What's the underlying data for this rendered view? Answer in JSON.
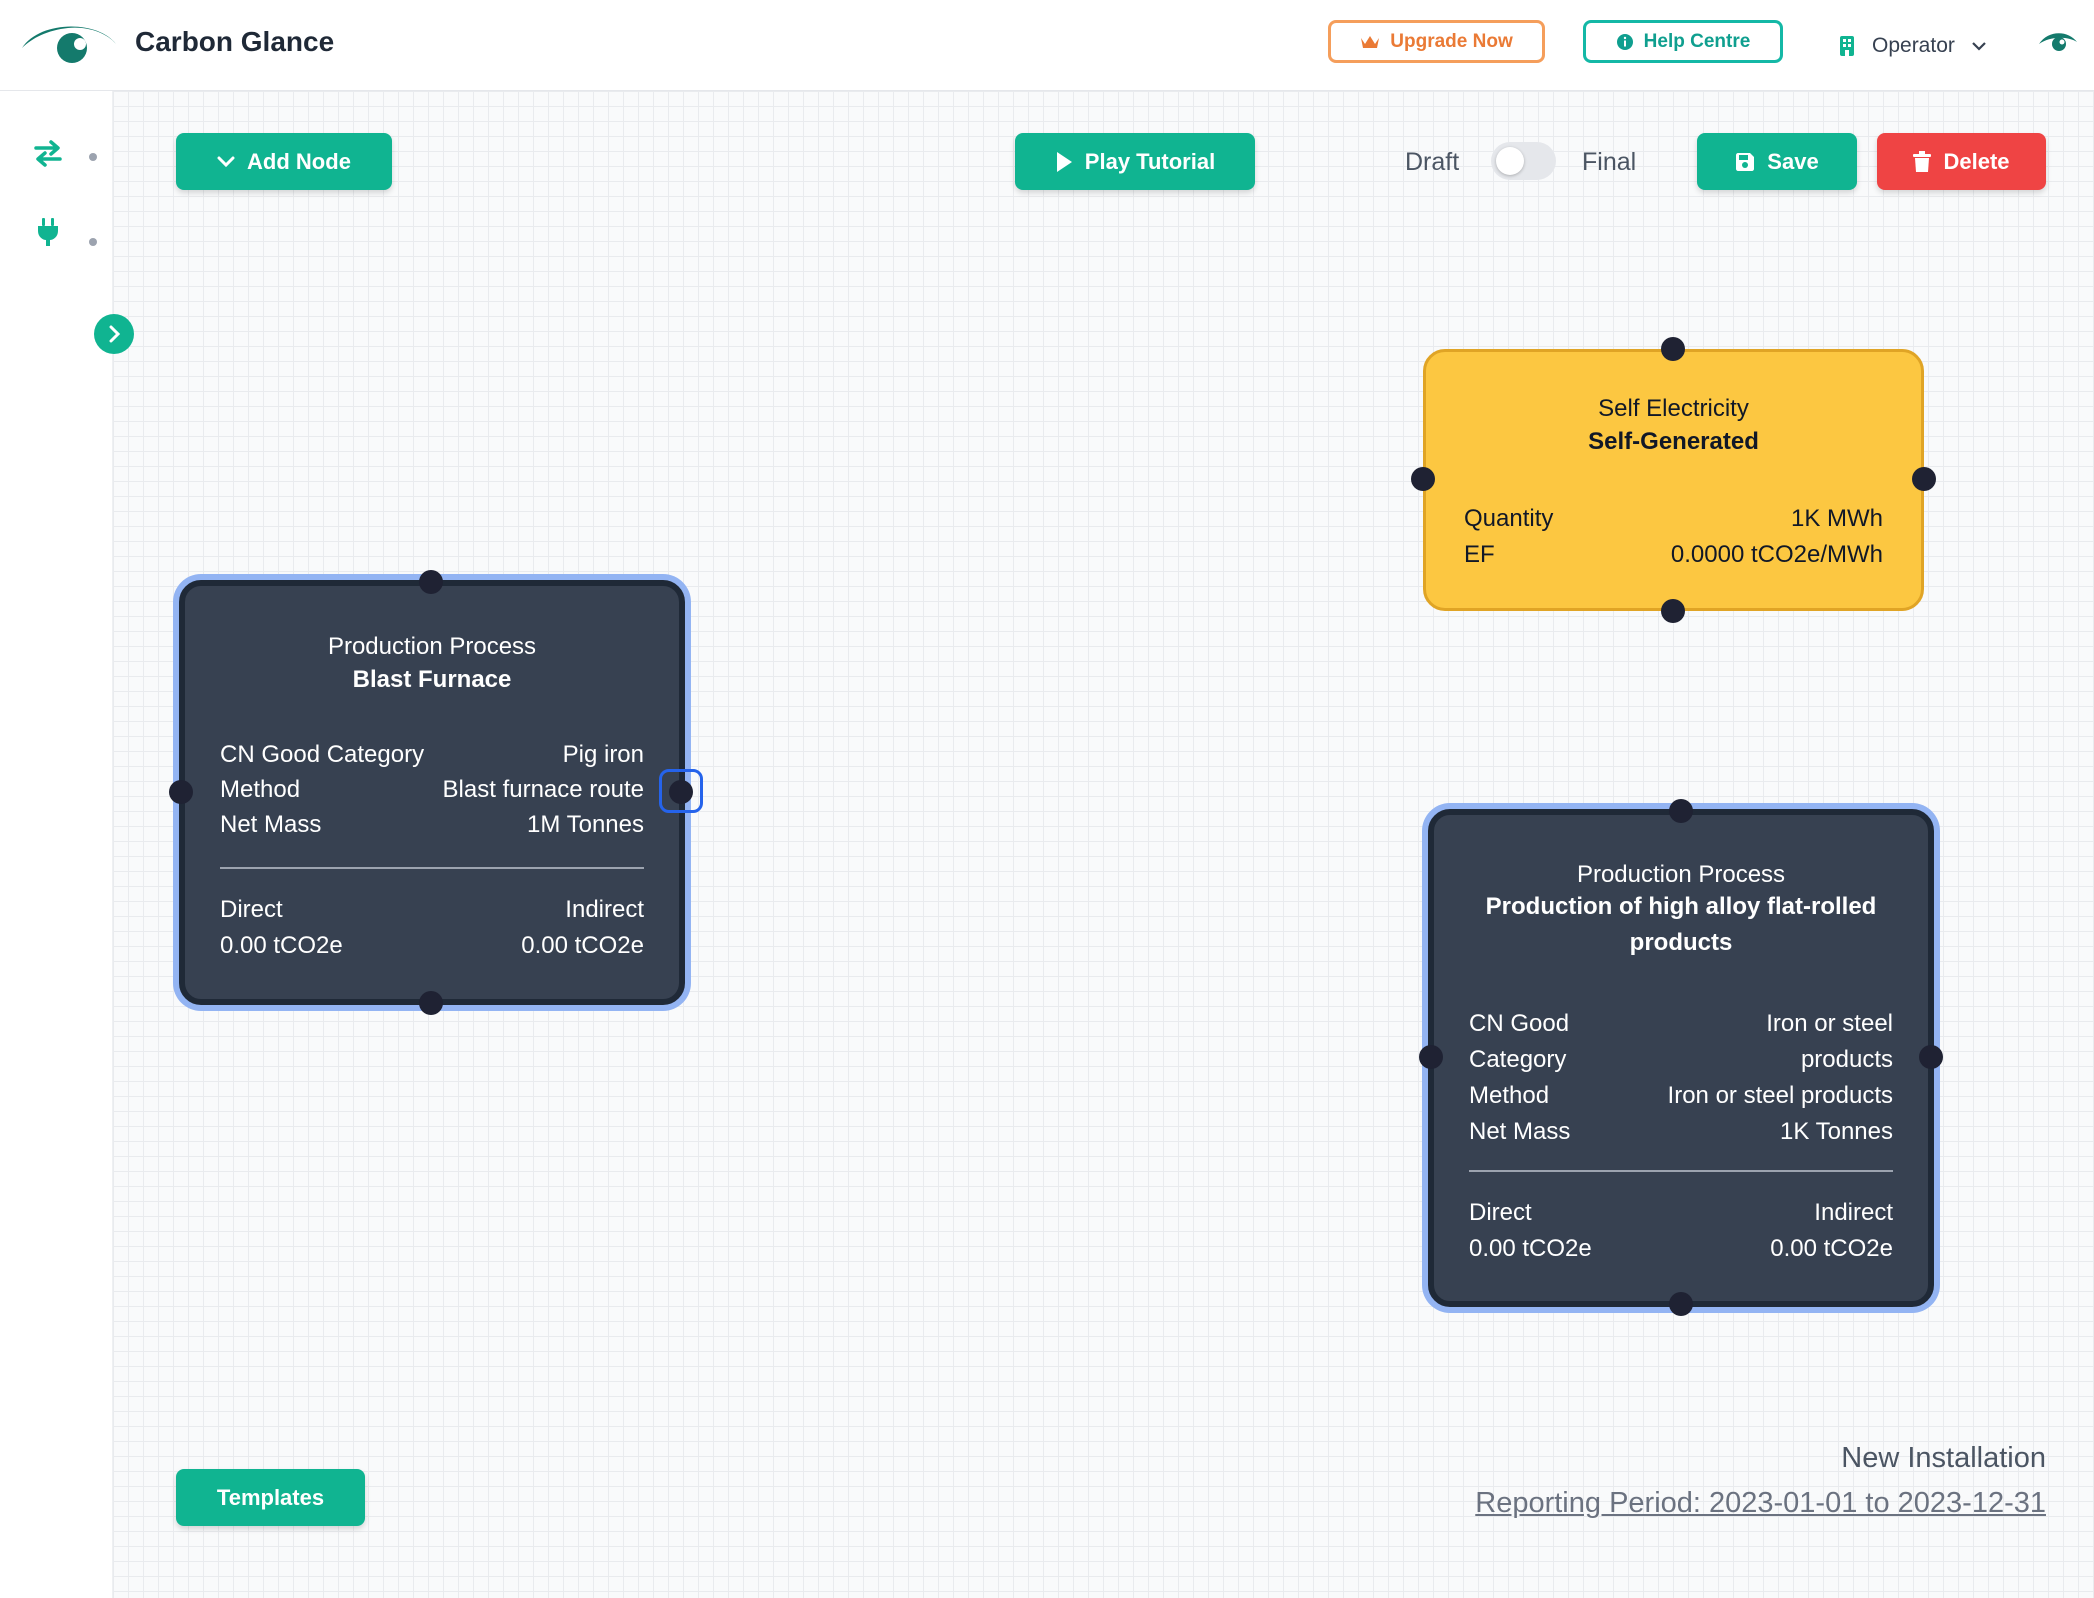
{
  "header": {
    "app_title": "Carbon Glance",
    "upgrade_label": "Upgrade Now",
    "help_label": "Help Centre",
    "user_role": "Operator",
    "brand_color": "#10b491"
  },
  "sidebar": {
    "items": [
      {
        "icon": "swap-arrows-icon"
      },
      {
        "icon": "plug-icon"
      }
    ],
    "expand_icon": "chevron-right-icon"
  },
  "toolbar": {
    "add_node_label": "Add Node",
    "play_tutorial_label": "Play Tutorial",
    "draft_label": "Draft",
    "final_label": "Final",
    "final_toggle_on": false,
    "save_label": "Save",
    "delete_label": "Delete",
    "templates_label": "Templates"
  },
  "nodes": {
    "blast_furnace": {
      "type": "Production Process",
      "name": "Blast Furnace",
      "rows": [
        {
          "label": "CN Good Category",
          "value": "Pig iron"
        },
        {
          "label": "Method",
          "value": "Blast furnace route"
        },
        {
          "label": "Net Mass",
          "value": "1M Tonnes"
        }
      ],
      "direct_label": "Direct",
      "direct_value": "0.00 tCO2e",
      "indirect_label": "Indirect",
      "indirect_value": "0.00 tCO2e"
    },
    "self_electricity": {
      "type": "Self Electricity",
      "name": "Self-Generated",
      "rows": [
        {
          "label": "Quantity",
          "value": "1K MWh"
        },
        {
          "label": "EF",
          "value": "0.0000 tCO2e/MWh"
        }
      ]
    },
    "flat_rolled": {
      "type": "Production Process",
      "name": "Production of high alloy flat-rolled products",
      "rows": [
        {
          "label": "CN Good Category",
          "value": "Iron or steel products"
        },
        {
          "label": "Method",
          "value": "Iron or steel products"
        },
        {
          "label": "Net Mass",
          "value": "1K Tonnes"
        }
      ],
      "direct_label": "Direct",
      "direct_value": "0.00 tCO2e",
      "indirect_label": "Indirect",
      "indirect_value": "0.00 tCO2e"
    }
  },
  "footer": {
    "installation_name": "New Installation",
    "reporting_period": "Reporting Period: 2023-01-01 to 2023-12-31"
  }
}
